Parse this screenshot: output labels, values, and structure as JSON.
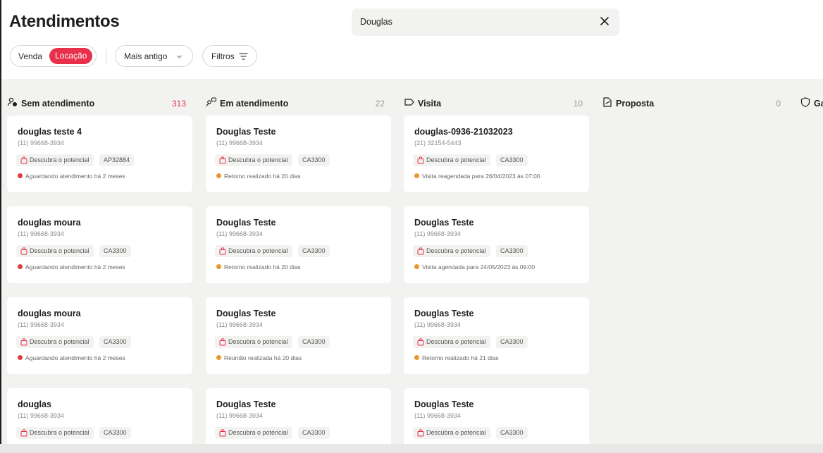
{
  "header": {
    "title": "Atendimentos",
    "search_value": "Douglas",
    "filters": {
      "venda": "Venda",
      "locacao": "Locação",
      "sort": "Mais antigo",
      "filtros": "Filtros"
    }
  },
  "colors": {
    "accent": "#e8304a",
    "red_dot": "#e03c3c",
    "orange_dot": "#e69a2e"
  },
  "columns": [
    {
      "title": "Sem atendimento",
      "count": "313",
      "icon": "users-icon",
      "cards": [
        {
          "name": "douglas teste 4",
          "phone": "(11) 99668-3934",
          "tag1": "Descubra o potencial",
          "tag2": "AP32884",
          "status": "Aguardando atendimento há 2 meses",
          "dot": "red"
        },
        {
          "name": "douglas moura",
          "phone": "(11) 99668-3934",
          "tag1": "Descubra o potencial",
          "tag2": "CA3300",
          "status": "Aguardando atendimento há 2 meses",
          "dot": "red"
        },
        {
          "name": "douglas moura",
          "phone": "(11) 99668-3934",
          "tag1": "Descubra o potencial",
          "tag2": "CA3300",
          "status": "Aguardando atendimento há 2 meses",
          "dot": "red"
        },
        {
          "name": "douglas",
          "phone": "(11) 99668-3934",
          "tag1": "Descubra o potencial",
          "tag2": "CA3300",
          "status": "",
          "dot": "red"
        }
      ]
    },
    {
      "title": "Em atendimento",
      "count": "22",
      "icon": "chat-users-icon",
      "cards": [
        {
          "name": "Douglas Teste",
          "phone": "(11) 99668-3934",
          "tag1": "Descubra o potencial",
          "tag2": "CA3300",
          "status": "Retorno realizado há 20 dias",
          "dot": "orange"
        },
        {
          "name": "Douglas Teste",
          "phone": "(11) 99668-3934",
          "tag1": "Descubra o potencial",
          "tag2": "CA3300",
          "status": "Retorno realizado há 20 dias",
          "dot": "orange"
        },
        {
          "name": "Douglas Teste",
          "phone": "(11) 99668-3934",
          "tag1": "Descubra o potencial",
          "tag2": "CA3300",
          "status": "Reunião realizada há 20 dias",
          "dot": "orange"
        },
        {
          "name": "Douglas Teste",
          "phone": "(11) 99668-3934",
          "tag1": "Descubra o potencial",
          "tag2": "CA3300",
          "status": "",
          "dot": "orange"
        }
      ]
    },
    {
      "title": "Visita",
      "count": "10",
      "icon": "tag-icon",
      "cards": [
        {
          "name": "douglas-0936-21032023",
          "phone": "(21) 32154-5443",
          "tag1": "Descubra o potencial",
          "tag2": "CA3300",
          "status": "Visita reagendada para 26/04/2023 às 07:00",
          "dot": "orange"
        },
        {
          "name": "Douglas Teste",
          "phone": "(11) 99668-3934",
          "tag1": "Descubra o potencial",
          "tag2": "CA3300",
          "status": "Visita agendada para 24/05/2023 às 09:00",
          "dot": "orange"
        },
        {
          "name": "Douglas Teste",
          "phone": "(11) 99668-3934",
          "tag1": "Descubra o potencial",
          "tag2": "CA3300",
          "status": "Retorno realizado há 21 dias",
          "dot": "orange"
        },
        {
          "name": "Douglas Teste",
          "phone": "(11) 99668-3934",
          "tag1": "Descubra o potencial",
          "tag2": "CA3300",
          "status": "",
          "dot": "orange"
        }
      ]
    },
    {
      "title": "Proposta",
      "count": "0",
      "icon": "document-icon",
      "cards": []
    },
    {
      "title": "Ga",
      "count": "",
      "icon": "shield-icon",
      "cards": []
    }
  ]
}
